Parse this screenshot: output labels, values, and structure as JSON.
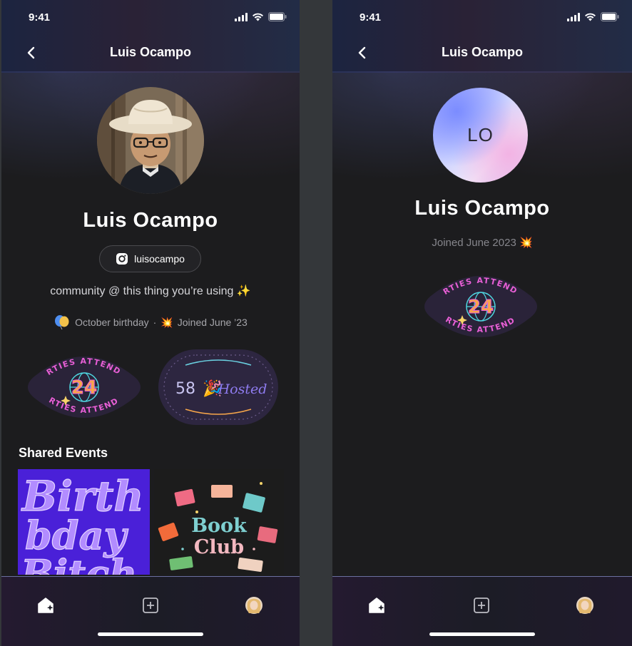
{
  "left_screen": {
    "status_time": "9:41",
    "nav_title": "Luis Ocampo",
    "profile_name": "Luis Ocampo",
    "instagram_handle": "luisocampo",
    "bio": "community @ this thing you’re using ✨",
    "birthday": "October birthday",
    "separator": "·",
    "joined_emoji": "💥",
    "joined": "Joined June ’23",
    "badges": {
      "parties": {
        "number": "24",
        "label": "PARTIES ATTENDED"
      },
      "hosted": {
        "number": "58",
        "label": "Hosted"
      }
    },
    "shared_events_title": "Shared Events",
    "events": [
      {
        "art_text": "Birthday Bitch"
      },
      {
        "art_text_line1": "Book",
        "art_text_line2": "Club"
      }
    ]
  },
  "right_screen": {
    "status_time": "9:41",
    "nav_title": "Luis Ocampo",
    "initials": "LO",
    "profile_name": "Luis Ocampo",
    "joined": "Joined June 2023 💥",
    "badge": {
      "number": "24",
      "label": "PARTIES ATTENDED"
    }
  },
  "colors": {
    "background": "#1c1c1e",
    "badge_bg": "#2a2339",
    "badge_pink": "#e85fd6",
    "badge_teal": "#4fd6e0",
    "badge_orange": "#f7a64a"
  },
  "icons": {
    "back": "chevron-left-icon",
    "instagram": "instagram-icon",
    "home_tab": "home-icon",
    "create_tab": "plus-square-icon",
    "profile_tab": "avatar"
  }
}
